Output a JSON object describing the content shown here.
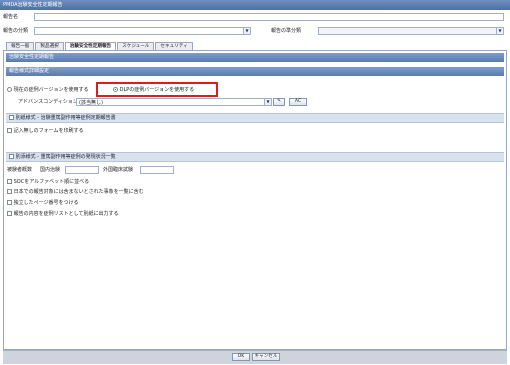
{
  "window": {
    "title": "PMDA治験安全性定期報告"
  },
  "header": {
    "report_name_label": "報告名",
    "report_name_value": "",
    "report_class_label": "報告の分類",
    "report_class_value": "",
    "report_rule_label": "報告の準分類",
    "report_rule_value": ""
  },
  "tabs": [
    {
      "label": "報告一般"
    },
    {
      "label": "製品選択"
    },
    {
      "label": "治験安全性定期報告"
    },
    {
      "label": "スケジュール"
    },
    {
      "label": "セキュリティ"
    }
  ],
  "panel": {
    "title": "治験安全性定期報告",
    "sub_title": "報告様式詳細設定",
    "radio_current": "現在の症例バージョンを使用する",
    "radio_dlp": "DLPの症例バージョンを使用する",
    "advanced_label": "アドバンスコンディション",
    "advanced_value": "(該当無し)",
    "advanced_btn": "AC",
    "section1": "別紙様式 - 治験重篤副作用等症例定期報告書",
    "check_blank_form": "記入無しのフォームを印刷する",
    "section2": "別添様式 - 重篤副作用等症例の発現状況一覧",
    "subjects_label": "被験者概数",
    "domestic_label": "国内治験",
    "foreign_label": "外国臨床試験",
    "check_soc": "SOCをアルファベット順に並べる",
    "check_japan": "日本での報告対象には含まないとされた事象を一覧に含む",
    "check_page": "独立したページ番号をつける",
    "check_list": "報告の内容を症例リストとして別紙に出力する"
  },
  "footer": {
    "ok_label": "OK",
    "cancel_label": "キャンセル"
  }
}
